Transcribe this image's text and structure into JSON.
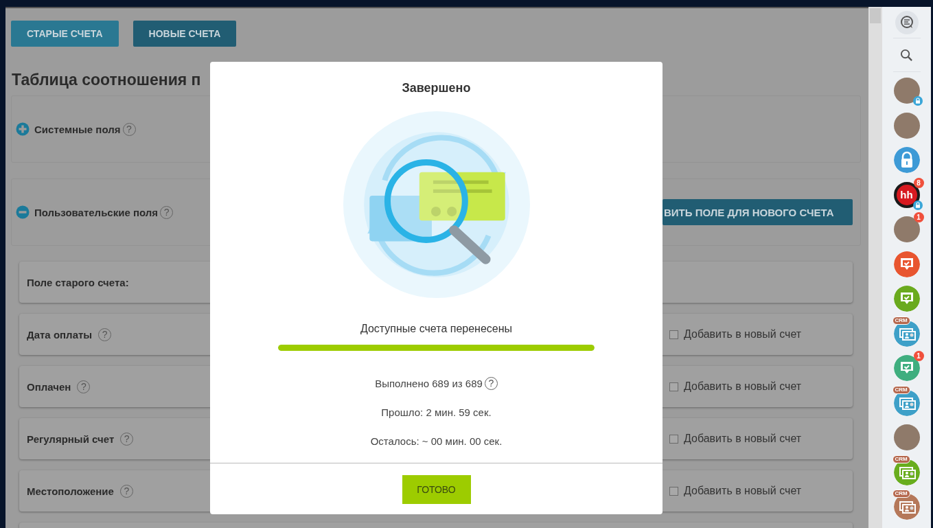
{
  "tabs": [
    {
      "label": "СТАРЫЕ СЧЕТА",
      "selected": false
    },
    {
      "label": "НОВЫЕ СЧЕТА",
      "selected": true
    }
  ],
  "page_title": "Таблица соотношения п",
  "sections": [
    {
      "label": "Системные поля",
      "help": "?",
      "expanded": false
    },
    {
      "label": "Пользовательские поля",
      "help": "?",
      "expanded": true,
      "action_button": "ВИТЬ ПОЛЕ ДЛЯ НОВОГО СЧЕТА"
    }
  ],
  "mapping_header": "Поле старого счета:",
  "fields": [
    {
      "label": "Дата оплаты",
      "help": "?",
      "checkbox_label": "Добавить в новый счет",
      "checked": false
    },
    {
      "label": "Оплачен",
      "help": "?",
      "checkbox_label": "Добавить в новый счет",
      "checked": false
    },
    {
      "label": "Регулярный счет",
      "help": "?",
      "checkbox_label": "Добавить в новый счет",
      "checked": false
    },
    {
      "label": "Местоположение",
      "help": "?",
      "checkbox_label": "Добавить в новый счет",
      "checked": false
    }
  ],
  "dialog": {
    "title": "Завершено",
    "status": "Доступные счета перенесены",
    "progress": {
      "level": 1
    },
    "done_count": "Выполнено 689 из 689",
    "help": "?",
    "elapsed": "Прошло: 2 мин. 59 сек.",
    "remaining": "Осталось: ~ 00 мин. 00 сек.",
    "button": "ГОТОВО"
  },
  "sidebar": {
    "items": [
      {
        "kind": "chat"
      },
      {
        "kind": "search"
      },
      {
        "kind": "photo",
        "locked": true
      },
      {
        "kind": "photo"
      },
      {
        "kind": "lock-app"
      },
      {
        "kind": "logo",
        "text": "hh",
        "badge": "8",
        "locked": true
      },
      {
        "kind": "photo",
        "badge": "1"
      },
      {
        "kind": "task",
        "color": "#e8552f"
      },
      {
        "kind": "task",
        "color": "#6aaa1e"
      },
      {
        "kind": "crm",
        "color": "#3ea0c8",
        "tag": "CRM"
      },
      {
        "kind": "task",
        "color": "#3fae7f",
        "badge": "1"
      },
      {
        "kind": "crm",
        "color": "#3ea0c8",
        "tag": "CRM"
      },
      {
        "kind": "photo"
      },
      {
        "kind": "crm",
        "color": "#68ad1e",
        "tag": "CRM"
      },
      {
        "kind": "crm",
        "color": "#b5785a",
        "tag": "CRM"
      }
    ]
  }
}
